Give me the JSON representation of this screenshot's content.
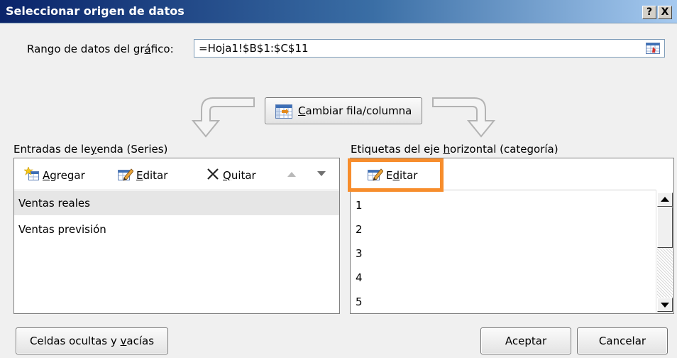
{
  "dialog": {
    "title": "Seleccionar origen de datos",
    "help_label": "?",
    "close_label": "X"
  },
  "range": {
    "label_pre": "Rango de datos del gr",
    "label_access": "á",
    "label_post": "fico:",
    "value": "=Hoja1!$B$1:$C$11"
  },
  "switch_button": {
    "access_key": "C",
    "label_rest": "ambiar fila/columna"
  },
  "legend_section": {
    "title_pre": "Entradas de le",
    "title_access": "y",
    "title_post": "enda (Series)",
    "add_access": "A",
    "add_rest": "gregar",
    "edit_access": "E",
    "edit_rest": "ditar",
    "remove_access": "Q",
    "remove_rest": "uitar",
    "series": [
      "Ventas reales",
      "Ventas previsión"
    ],
    "selected_index": 0
  },
  "axis_section": {
    "title_pre": "Etiquetas del eje ",
    "title_access": "h",
    "title_post": "orizontal (categoría)",
    "edit_pre": "E",
    "edit_access": "d",
    "edit_post": "itar",
    "categories": [
      "1",
      "2",
      "3",
      "4",
      "5"
    ]
  },
  "buttons": {
    "hidden_pre": "Celdas ocultas y ",
    "hidden_access": "v",
    "hidden_post": "acías",
    "ok": "Aceptar",
    "cancel": "Cancelar"
  },
  "colors": {
    "highlight": "#f78d2c",
    "title_bar": "#0a246a"
  }
}
